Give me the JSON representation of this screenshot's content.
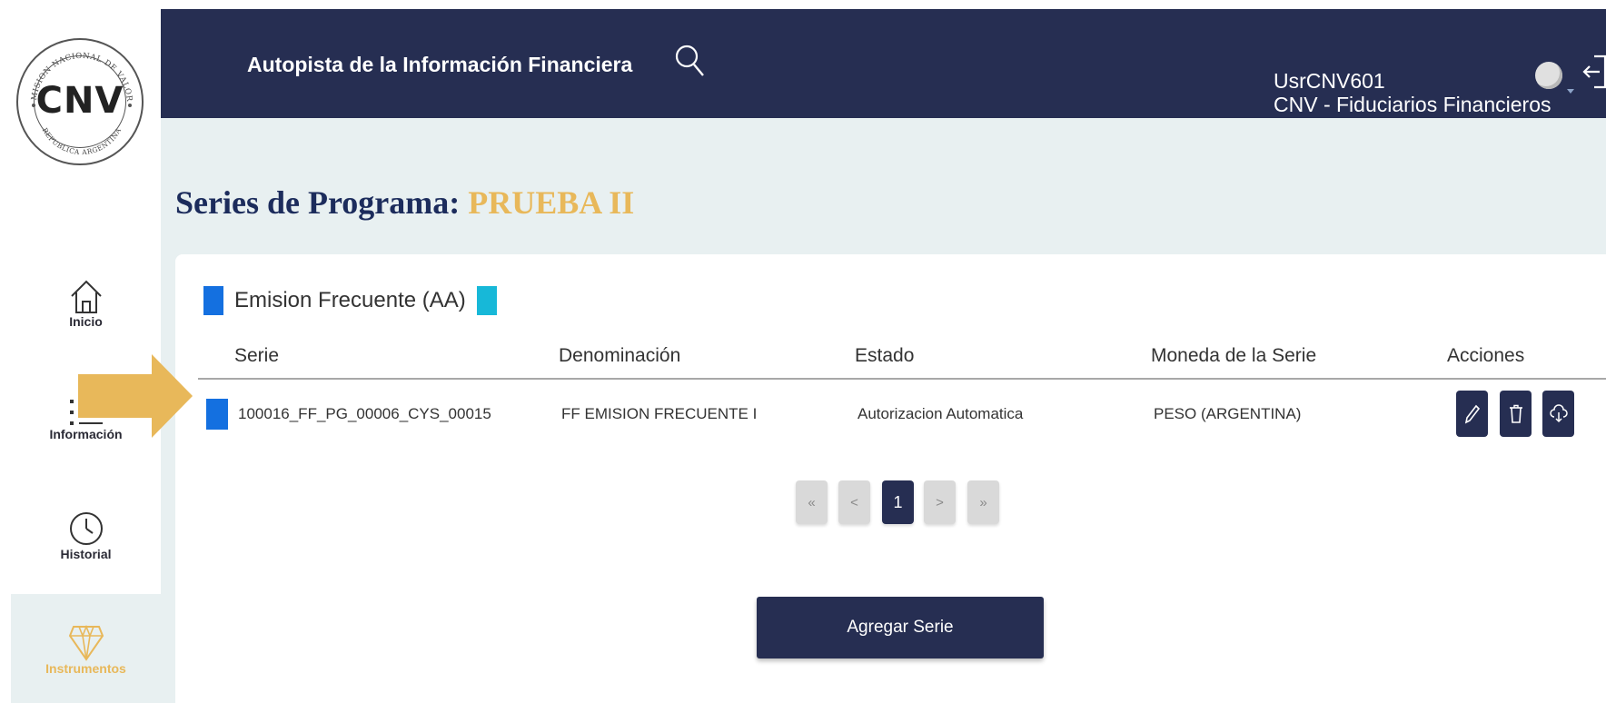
{
  "brand": {
    "logo_text": "CNV",
    "logo_ring_top": "COMISION NACIONAL DE VALORES",
    "logo_ring_bottom": "REPUBLICA ARGENTINA"
  },
  "sidebar": {
    "items": [
      {
        "label": "Inicio",
        "icon": "home-icon"
      },
      {
        "label": "Información",
        "icon": "list-icon"
      },
      {
        "label": "Historial",
        "icon": "clock-icon"
      },
      {
        "label": "Instrumentos",
        "icon": "diamond-icon",
        "active": true
      }
    ]
  },
  "header": {
    "title": "Autopista de la Información Financiera",
    "user_name": "UsrCNV601",
    "user_role": "CNV - Fiduciarios Financieros"
  },
  "page": {
    "title_prefix": "Series de Programa:",
    "program_name": "PRUEBA II"
  },
  "section": {
    "label": "Emision Frecuente (AA)"
  },
  "table": {
    "headers": [
      "Serie",
      "Denominación",
      "Estado",
      "Moneda de la Serie",
      "Acciones"
    ],
    "rows": [
      {
        "serie": "100016_FF_PG_00006_CYS_00015",
        "denominacion": "FF EMISION FRECUENTE I",
        "estado": "Autorizacion Automatica",
        "moneda": "PESO (ARGENTINA)"
      }
    ],
    "actions": [
      "edit-icon",
      "trash-icon",
      "cloud-download-icon"
    ]
  },
  "pagination": {
    "first": "«",
    "prev": "<",
    "current": "1",
    "next": ">",
    "last": "»"
  },
  "buttons": {
    "add_serie": "Agregar Serie"
  },
  "colors": {
    "header_bg": "#262e52",
    "accent_gold": "#e8b85a",
    "title_navy": "#1c2c5c",
    "square_blue": "#1470e0",
    "square_cyan": "#17b8d8",
    "content_bg": "#e8f0f1"
  }
}
